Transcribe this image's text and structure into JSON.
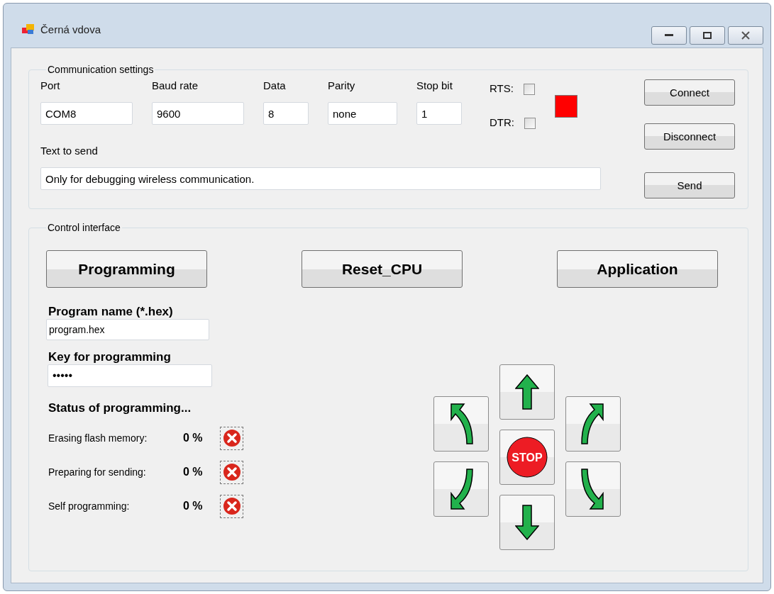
{
  "window": {
    "title": "Černá vdova"
  },
  "communication": {
    "title": "Communication settings",
    "fields": [
      {
        "label": "Port",
        "value": "COM8"
      },
      {
        "label": "Baud rate",
        "value": "9600"
      },
      {
        "label": "Data",
        "value": "8"
      },
      {
        "label": "Parity",
        "value": "none"
      },
      {
        "label": "Stop bit",
        "value": "1"
      }
    ],
    "checkboxes": [
      {
        "label": "RTS:",
        "checked": false
      },
      {
        "label": "DTR:",
        "checked": false
      }
    ],
    "connected": false,
    "text_label": "Text to send",
    "text_value": "Only for debugging wireless communication.",
    "buttons": [
      "Connect",
      "Disconnect",
      "Send"
    ]
  },
  "control": {
    "title": "Control interface",
    "mode_buttons": [
      "Programming",
      "Reset_CPU",
      "Application"
    ],
    "program_name_label": "Program name (*.hex)",
    "program_name": "program.hex",
    "key_label": "Key for programming",
    "key_value": "•••••",
    "status_title": "Status of programming...",
    "status_rows": [
      {
        "label": "Erasing flash memory:",
        "percent": "0 %",
        "failed": true
      },
      {
        "label": "Preparing for sending:",
        "percent": "0 %",
        "failed": true
      },
      {
        "label": "Self programming:",
        "percent": "0 %",
        "failed": true
      }
    ],
    "stop_label": "STOP"
  }
}
